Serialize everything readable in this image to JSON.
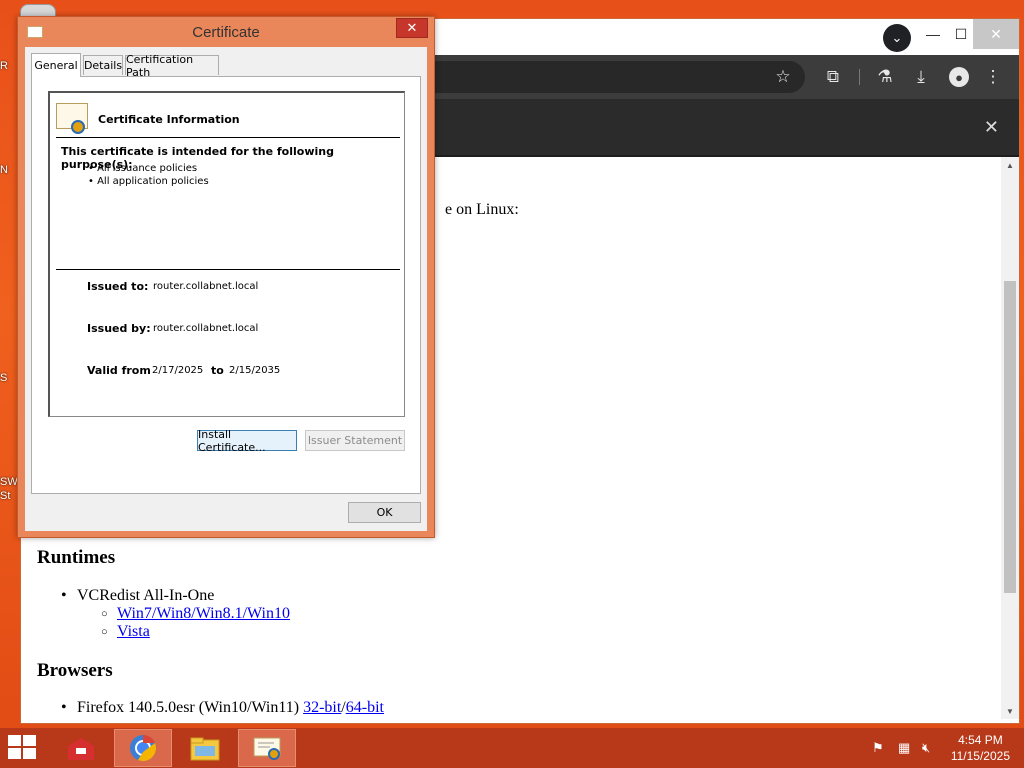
{
  "desktop": {
    "fragments": [
      "R",
      "N",
      "S",
      "SW",
      "St"
    ]
  },
  "browser": {
    "profile_glyph": "⌄",
    "minimize": "—",
    "maximize": "☐",
    "close": "✕",
    "toolbar_icons": [
      "star-icon",
      "extensions-icon",
      "labs-icon",
      "download-icon",
      "profile-icon",
      "menu-icon"
    ],
    "infobar_close": "✕",
    "page": {
      "fragment_text": "e on Linux:",
      "sections": [
        {
          "heading": "Runtimes",
          "items": [
            {
              "text": "VCRedist All-In-One",
              "links": [
                "Win7/Win8/Win8.1/Win10",
                "Vista"
              ]
            }
          ]
        },
        {
          "heading": "Browsers",
          "items": [
            {
              "text": "Firefox 140.5.0esr (Win10/Win11) ",
              "link1": "32-bit",
              "sep": "/",
              "link2": "64-bit"
            }
          ]
        }
      ]
    }
  },
  "dialog": {
    "title": "Certificate",
    "close": "✕",
    "tabs": [
      "General",
      "Details",
      "Certification Path"
    ],
    "active_tab": "General",
    "info_heading": "Certificate Information",
    "purpose_heading": "This certificate is intended for the following purpose(s):",
    "purposes": [
      "• All issuance policies",
      "• All application policies"
    ],
    "issued_to_label": "Issued to:",
    "issued_to": "router.collabnet.local",
    "issued_by_label": "Issued by:",
    "issued_by": "router.collabnet.local",
    "valid_from_label": "Valid from",
    "valid_from": "2/17/2025",
    "valid_to_label": "to",
    "valid_to": "2/15/2035",
    "install_button": "Install Certificate...",
    "issuer_button": "Issuer Statement",
    "ok_button": "OK"
  },
  "taskbar": {
    "time": "4:54 PM",
    "date": "11/15/2025",
    "tray_icons": [
      "flag-icon",
      "network-icon",
      "volume-muted-icon"
    ]
  }
}
